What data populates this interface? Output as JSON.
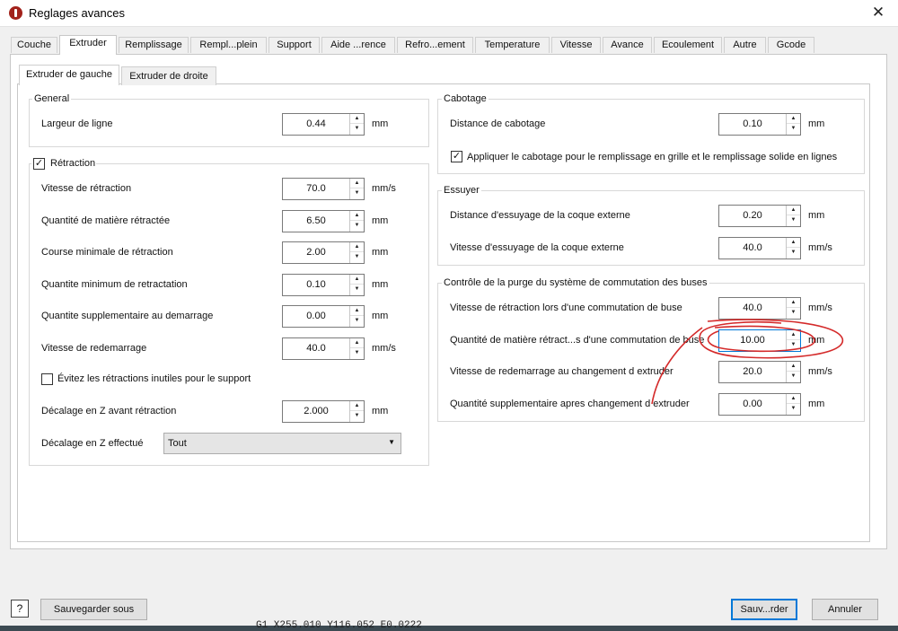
{
  "window": {
    "title": "Reglages avances",
    "close_glyph": "✕"
  },
  "tabs": [
    "Couche",
    "Extruder",
    "Remplissage",
    "Rempl...plein",
    "Support",
    "Aide ...rence",
    "Refro...ement",
    "Temperature",
    "Vitesse",
    "Avance",
    "Ecoulement",
    "Autre",
    "Gcode"
  ],
  "active_tab": "Extruder",
  "subtabs": [
    "Extruder de gauche",
    "Extruder de droite"
  ],
  "general": {
    "title": "General",
    "rows": [
      {
        "label": "Largeur de ligne",
        "value": "0.44",
        "unit": "mm"
      }
    ]
  },
  "retraction": {
    "title": "Rétraction",
    "checked": true,
    "rows": [
      {
        "label": "Vitesse de rétraction",
        "value": "70.0",
        "unit": "mm/s"
      },
      {
        "label": "Quantité de matière rétractée",
        "value": "6.50",
        "unit": "mm"
      },
      {
        "label": "Course minimale de rétraction",
        "value": "2.00",
        "unit": "mm"
      },
      {
        "label": "Quantite minimum de retractation",
        "value": "0.10",
        "unit": "mm"
      },
      {
        "label": "Quantite supplementaire au demarrage",
        "value": "0.00",
        "unit": "mm"
      },
      {
        "label": "Vitesse de redemarrage",
        "value": "40.0",
        "unit": "mm/s"
      }
    ],
    "avoid_checkbox": {
      "label": "Évitez les rétractions inutiles pour le support",
      "checked": false
    },
    "z_offset": {
      "label": "Décalage en Z avant rétraction",
      "value": "2.000",
      "unit": "mm"
    },
    "z_effect": {
      "label": "Décalage en Z effectué",
      "value": "Tout"
    }
  },
  "cabotage": {
    "title": "Cabotage",
    "rows": [
      {
        "label": "Distance de cabotage",
        "value": "0.10",
        "unit": "mm"
      }
    ],
    "checkbox": {
      "label": "Appliquer le cabotage pour le remplissage en grille et le remplissage solide en lignes",
      "checked": true
    }
  },
  "essuyer": {
    "title": "Essuyer",
    "rows": [
      {
        "label": "Distance d'essuyage de la coque externe",
        "value": "0.20",
        "unit": "mm"
      },
      {
        "label": "Vitesse d'essuyage de la coque externe",
        "value": "40.0",
        "unit": "mm/s"
      }
    ]
  },
  "purge": {
    "title": "Contrôle de la purge du système de commutation des buses",
    "rows": [
      {
        "label": "Vitesse de rétraction lors d'une commutation de buse",
        "value": "40.0",
        "unit": "mm/s"
      },
      {
        "label": "Quantité de matière rétract...s d'une commutation de buse",
        "value": "10.00",
        "unit": "mm"
      },
      {
        "label": "Vitesse de redemarrage au changement d extruder",
        "value": "20.0",
        "unit": "mm/s"
      },
      {
        "label": "Quantité supplementaire apres changement d extruder",
        "value": "0.00",
        "unit": "mm"
      }
    ]
  },
  "buttons": {
    "help": "?",
    "save_as": "Sauvegarder sous",
    "save": "Sauv...rder",
    "cancel": "Annuler"
  },
  "annotation": {
    "color": "#d42a2a"
  },
  "background": {
    "console_text": "G1 X255.010 Y116.052 E0.0222"
  },
  "colors": {
    "focus_border": "#0078d7",
    "window_bg": "#f0f0f0"
  }
}
